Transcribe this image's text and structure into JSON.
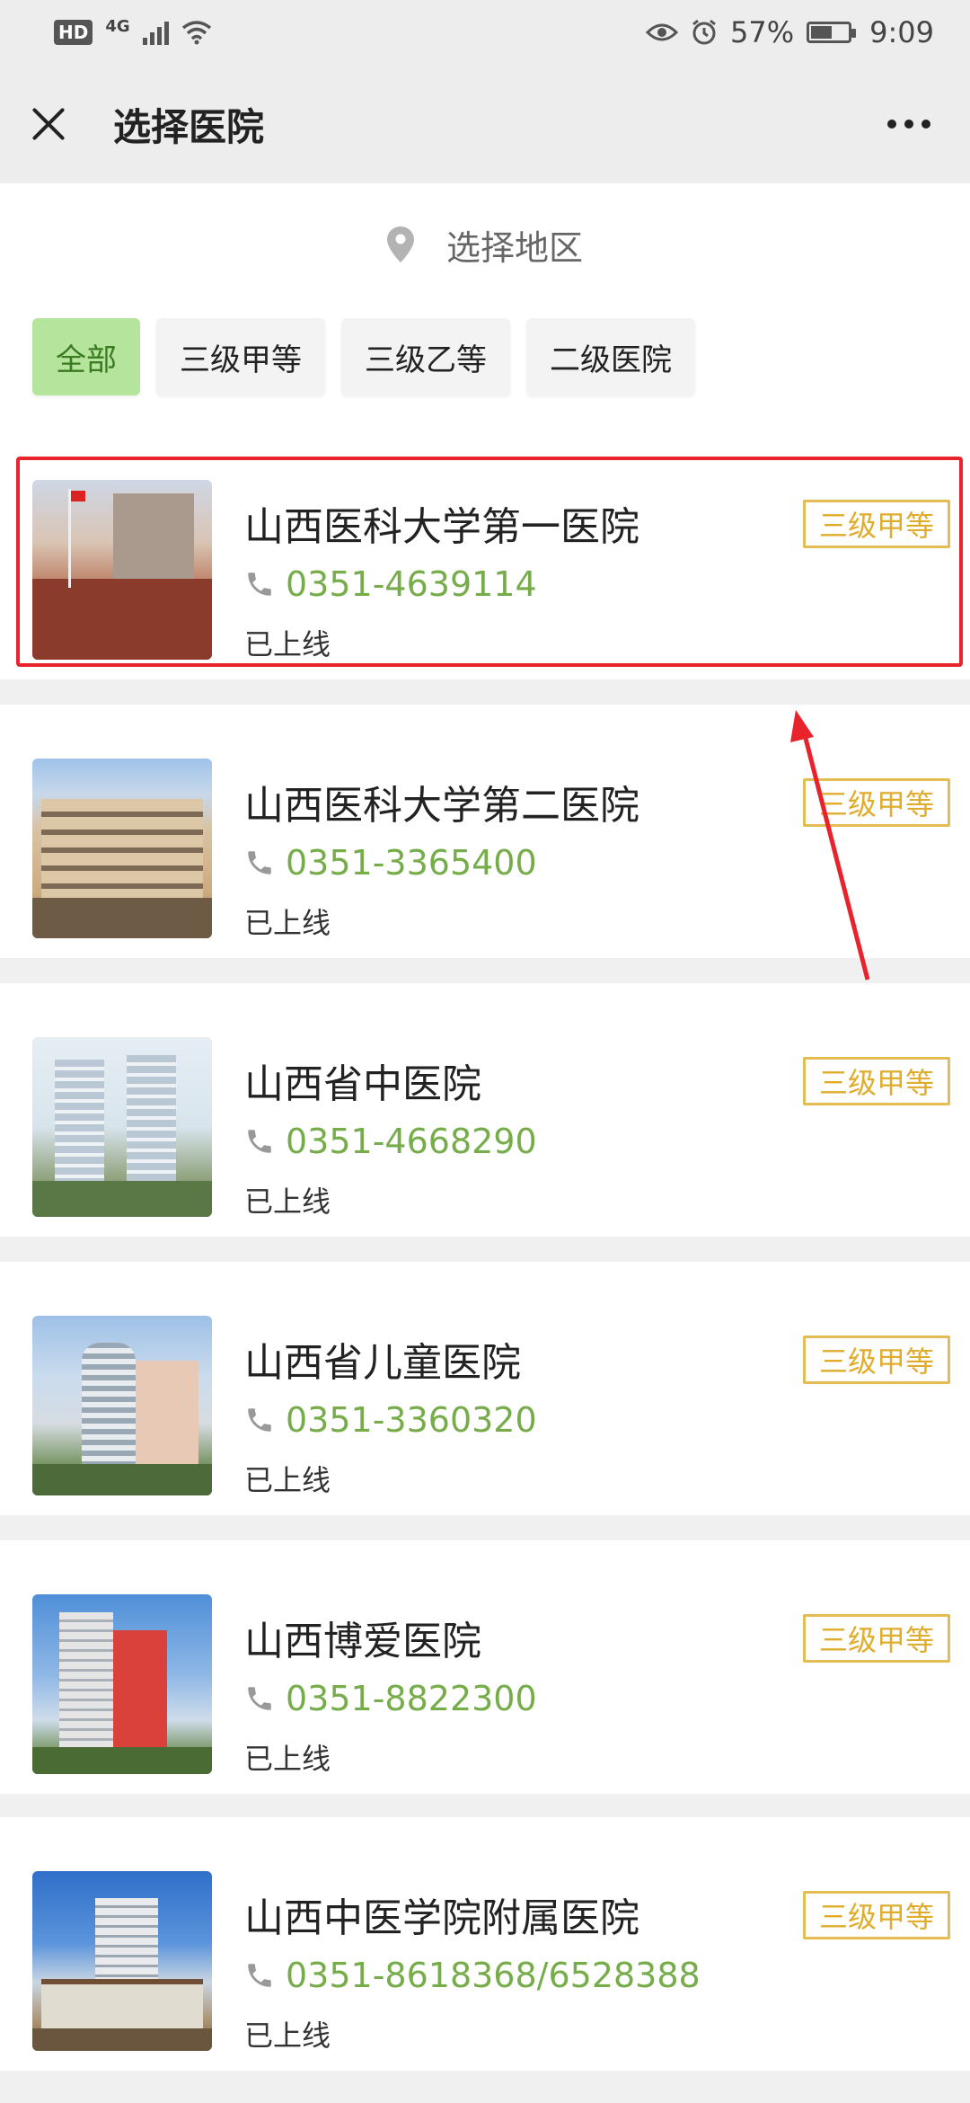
{
  "status_bar": {
    "hd": "HD",
    "network": "4G",
    "battery": "57%",
    "battery_level": 0.57,
    "time": "9:09"
  },
  "navbar": {
    "title": "选择医院",
    "close_icon": "close-icon",
    "more_icon": "more-dots-icon"
  },
  "filter": {
    "region_label": "选择地区",
    "region_icon": "location-pin-icon",
    "tabs": [
      {
        "label": "全部",
        "active": true
      },
      {
        "label": "三级甲等",
        "active": false
      },
      {
        "label": "三级乙等",
        "active": false
      },
      {
        "label": "二级医院",
        "active": false
      }
    ]
  },
  "hospitals": [
    {
      "name": "山西医科大学第一医院",
      "phone": "0351-4639114",
      "status": "已上线",
      "level": "三级甲等"
    },
    {
      "name": "山西医科大学第二医院",
      "phone": "0351-3365400",
      "status": "已上线",
      "level": "三级甲等"
    },
    {
      "name": "山西省中医院",
      "phone": "0351-4668290",
      "status": "已上线",
      "level": "三级甲等"
    },
    {
      "name": "山西省儿童医院",
      "phone": "0351-3360320",
      "status": "已上线",
      "level": "三级甲等"
    },
    {
      "name": "山西博爱医院",
      "phone": "0351-8822300",
      "status": "已上线",
      "level": "三级甲等"
    },
    {
      "name": "山西中医学院附属医院",
      "phone": "0351-8618368/6528388",
      "status": "已上线",
      "level": "三级甲等"
    }
  ],
  "colors": {
    "accent_green": "#76ad4a",
    "active_tab": "#b5e59c",
    "level_gold": "#e0ac2c",
    "highlight_red": "#e8232b"
  }
}
